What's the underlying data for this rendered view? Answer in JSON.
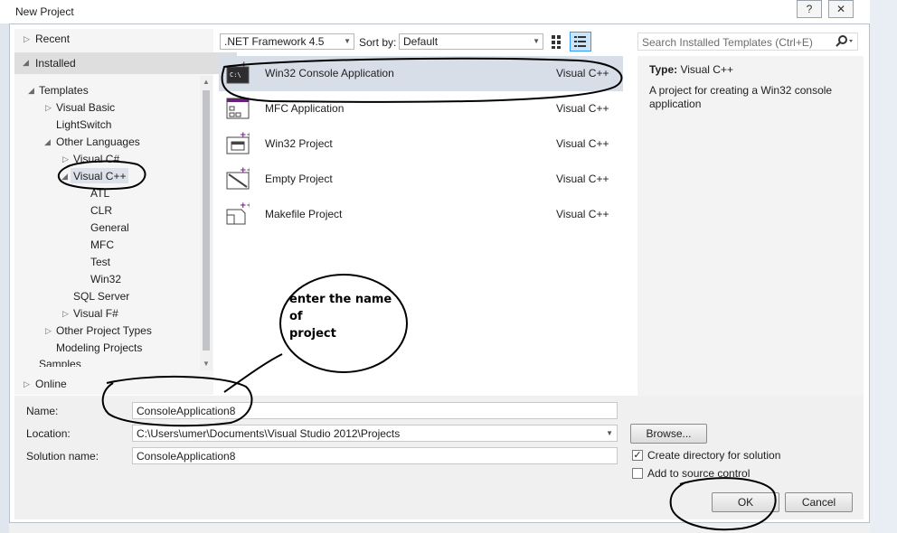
{
  "window": {
    "title": "New Project",
    "help_label": "?",
    "close_label": "✕"
  },
  "tree": {
    "recent": "Recent",
    "installed": "Installed",
    "templates": "Templates",
    "items": [
      "Visual Basic",
      "LightSwitch",
      "Other Languages",
      "Visual C#",
      "Visual C++",
      "ATL",
      "CLR",
      "General",
      "MFC",
      "Test",
      "Win32",
      "SQL Server",
      "Visual F#",
      "Other Project Types",
      "Modeling Projects",
      "Samples"
    ],
    "online": "Online"
  },
  "toolbar": {
    "framework": ".NET Framework 4.5",
    "sort_label": "Sort by:",
    "sort_value": "Default",
    "search_placeholder": "Search Installed Templates (Ctrl+E)",
    "icons": [
      "small-icons-view",
      "list-view",
      "search-icon"
    ]
  },
  "templates": [
    {
      "name": "Win32 Console Application",
      "lang": "Visual C++",
      "selected": true
    },
    {
      "name": "MFC Application",
      "lang": "Visual C++",
      "selected": false
    },
    {
      "name": "Win32 Project",
      "lang": "Visual C++",
      "selected": false
    },
    {
      "name": "Empty Project",
      "lang": "Visual C++",
      "selected": false
    },
    {
      "name": "Makefile Project",
      "lang": "Visual C++",
      "selected": false
    }
  ],
  "description": {
    "type_label": "Type:",
    "type_value": "Visual C++",
    "text": "A project for creating a Win32 console application"
  },
  "form": {
    "name_label": "Name:",
    "name_value": "ConsoleApplication8",
    "location_label": "Location:",
    "location_value": "C:\\Users\\umer\\Documents\\Visual Studio 2012\\Projects",
    "solution_label": "Solution name:",
    "solution_value": "ConsoleApplication8",
    "browse": "Browse...",
    "create_dir": "Create directory for solution",
    "create_dir_checked": true,
    "add_source": "Add to source control",
    "add_source_checked": false,
    "ok": "OK",
    "cancel": "Cancel"
  },
  "annotation": {
    "line1": "enter the name",
    "line2": "of",
    "line3": "project"
  }
}
